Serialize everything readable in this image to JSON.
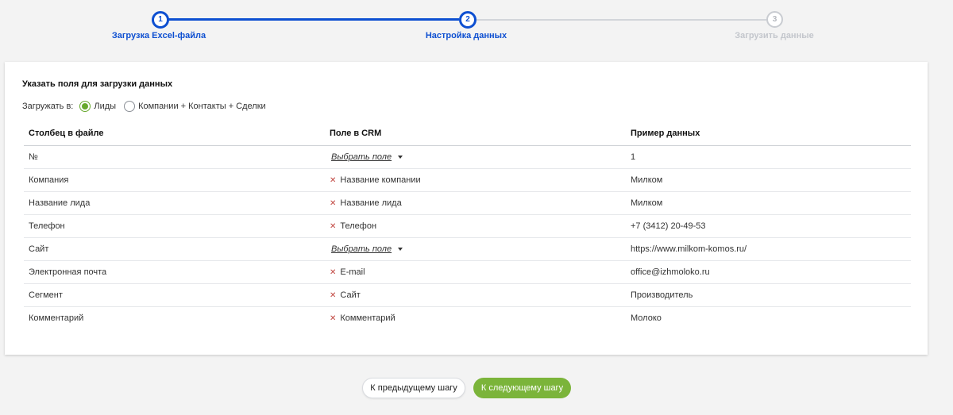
{
  "stepper": {
    "steps": [
      {
        "number": "1",
        "label": "Загрузка Excel-файла",
        "state": "done"
      },
      {
        "number": "2",
        "label": "Настройка данных",
        "state": "active"
      },
      {
        "number": "3",
        "label": "Загрузить данные",
        "state": "inactive"
      }
    ]
  },
  "form": {
    "title": "Указать поля для загрузки данных",
    "load_to_label": "Загружать в:",
    "options": [
      {
        "label": "Лиды",
        "checked": true
      },
      {
        "label": "Компании + Контакты + Сделки",
        "checked": false
      }
    ]
  },
  "table": {
    "headers": [
      "Столбец в файле",
      "Поле в CRM",
      "Пример данных"
    ],
    "select_label": "Выбрать поле",
    "rows": [
      {
        "column": "№",
        "crm_field": "",
        "example": "1"
      },
      {
        "column": "Компания",
        "crm_field": "Название компании",
        "example": "Милком"
      },
      {
        "column": "Название лида",
        "crm_field": "Название лида",
        "example": "Милком"
      },
      {
        "column": "Телефон",
        "crm_field": "Телефон",
        "example": "+7 (3412) 20-49-53"
      },
      {
        "column": "Сайт",
        "crm_field": "",
        "example": "https://www.milkom-komos.ru/"
      },
      {
        "column": "Электронная почта",
        "crm_field": "E-mail",
        "example": "office@izhmoloko.ru"
      },
      {
        "column": "Сегмент",
        "crm_field": "Сайт",
        "example": "Производитель"
      },
      {
        "column": "Комментарий",
        "crm_field": "Комментарий",
        "example": "Молоко"
      }
    ]
  },
  "buttons": {
    "prev": "К предыдущему шагу",
    "next": "К следующему шагу"
  },
  "colors": {
    "accent_blue": "#0d4fd1",
    "accent_green": "#7bb43a",
    "remove_red": "#c0443e"
  }
}
